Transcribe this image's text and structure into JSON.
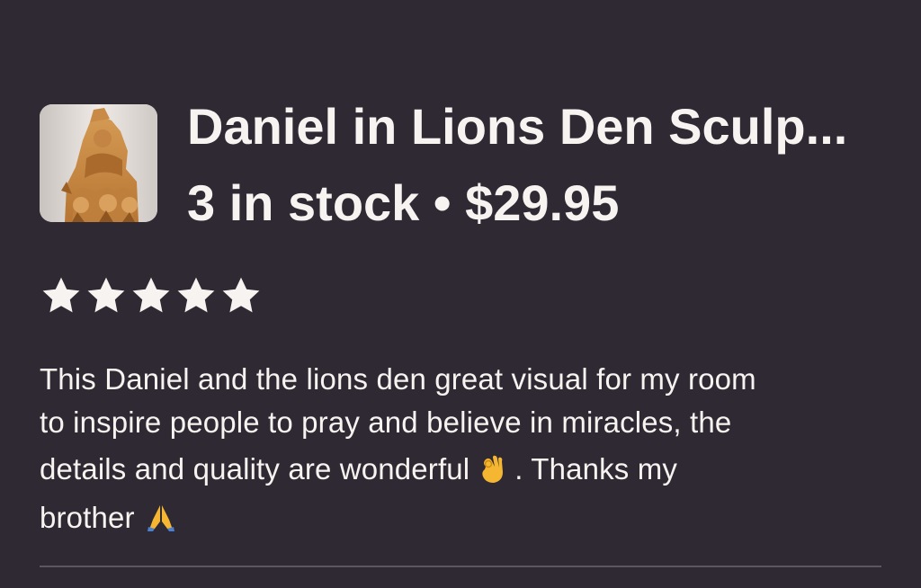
{
  "listing": {
    "title": "Daniel in Lions Den Sculp...",
    "stock": "3 in stock",
    "separator": "•",
    "price": "$29.95",
    "thumbnail_icon": "daniel-lions-sculpture-image"
  },
  "review": {
    "rating": 5,
    "rating_max": 5,
    "line1": "This Daniel and the lions den great visual for my room",
    "line2": "to inspire people to pray and believe in miracles, the",
    "line3a": "details and quality are wonderful",
    "line3b": ". Thanks my",
    "line4": "brother",
    "emoji_ok": "ok-hand-emoji",
    "emoji_pray": "folded-hands-emoji"
  },
  "colors": {
    "background": "#2f2933",
    "text": "#f6f3f0",
    "divider": "#5c5662"
  }
}
